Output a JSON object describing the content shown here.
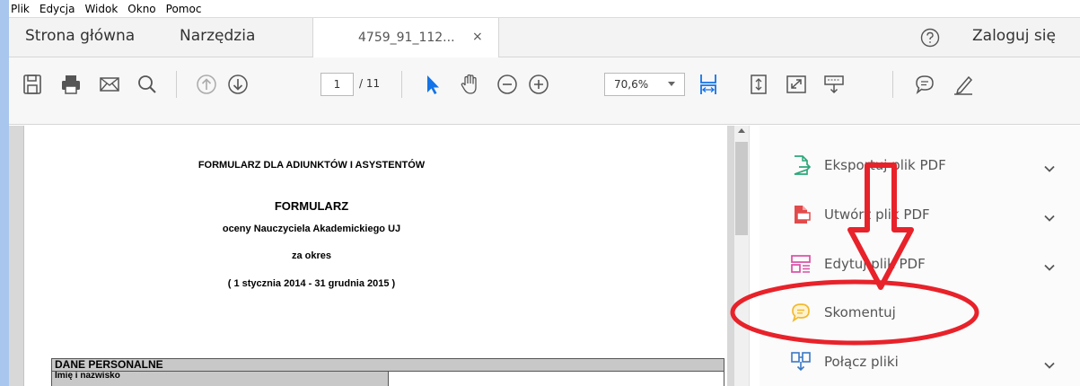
{
  "menu": [
    "Plik",
    "Edycja",
    "Widok",
    "Okno",
    "Pomoc"
  ],
  "tabs": {
    "home": "Strona główna",
    "tools": "Narzędzia",
    "document": "4759_91_112...",
    "close": "×"
  },
  "header": {
    "signin": "Zaloguj się"
  },
  "toolbar": {
    "page_current": "1",
    "page_total": "/ 11",
    "zoom": "70,6%"
  },
  "document": {
    "line1": "FORMULARZ DLA ADIUNKTÓW I ASYSTENTÓW",
    "line2": "FORMULARZ",
    "line3": "oceny Nauczyciela Akademickiego UJ",
    "line4": "za okres",
    "line5": "( 1 stycznia 2014  - 31 grudnia 2015 )",
    "section": "DANE PERSONALNE",
    "field1": "Imię i nazwisko"
  },
  "sidepanel": {
    "items": [
      {
        "label": "Eksportuj plik PDF",
        "icon": "export-pdf-icon",
        "color": "#2da77a",
        "has_chevron": true
      },
      {
        "label": "Utwórz plik PDF",
        "icon": "create-pdf-icon",
        "color": "#e24b4b",
        "has_chevron": true
      },
      {
        "label": "Edytuj plik PDF",
        "icon": "edit-pdf-icon",
        "color": "#d94fa6",
        "has_chevron": true
      },
      {
        "label": "Skomentuj",
        "icon": "comment-icon",
        "color": "#f2b931",
        "has_chevron": false
      },
      {
        "label": "Połącz pliki",
        "icon": "combine-files-icon",
        "color": "#3a78c4",
        "has_chevron": true
      }
    ]
  },
  "annotation": {
    "color": "#e8222a"
  }
}
